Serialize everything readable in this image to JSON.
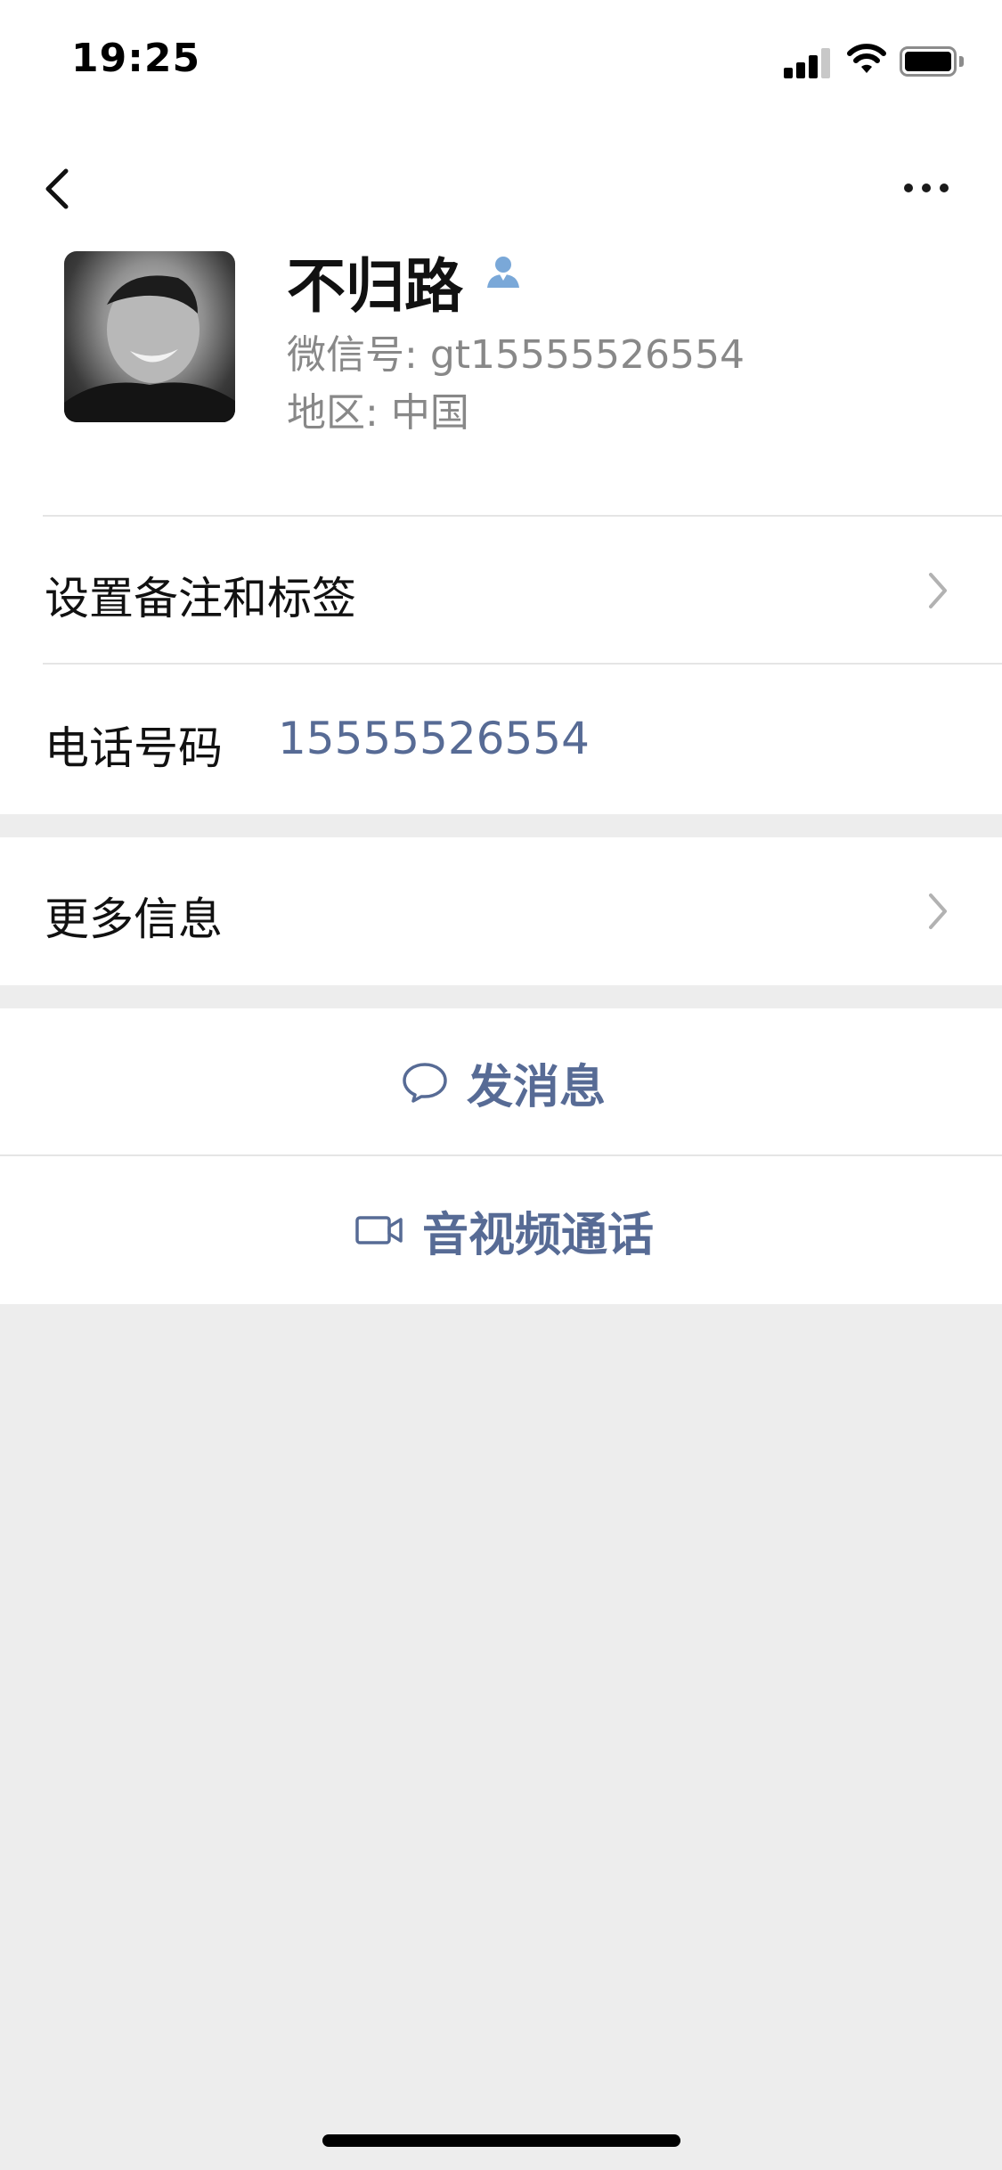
{
  "status_bar": {
    "time": "19:25"
  },
  "profile": {
    "name": "不归路",
    "wechat_id_label": "微信号:",
    "wechat_id": "gt15555526554",
    "region_label": "地区:",
    "region": "中国"
  },
  "rows": {
    "remark_tags": "设置备注和标签",
    "phone_label": "电话号码",
    "phone_value": "15555526554",
    "more_info": "更多信息"
  },
  "actions": {
    "send_message": "发消息",
    "av_call": "音视频通话"
  },
  "colors": {
    "link_blue": "#576b95",
    "background": "#ededed",
    "contact_icon_blue": "#7aa8d8"
  },
  "icons": [
    "back-arrow-icon",
    "more-dots-icon",
    "contact-person-icon",
    "chevron-right-icon",
    "chat-bubble-icon",
    "video-camera-icon"
  ]
}
